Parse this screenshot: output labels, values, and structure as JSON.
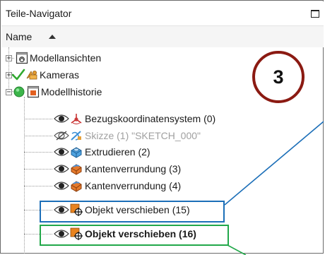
{
  "panel": {
    "title": "Teile-Navigator",
    "column_header": "Name"
  },
  "tree": {
    "items": [
      {
        "label": "Modellansichten",
        "icon": "model-views-icon",
        "expander": "+"
      },
      {
        "label": "Kameras",
        "icon": "camera-icon",
        "expander": "+"
      },
      {
        "label": "Modellhistorie",
        "icon": "model-history-icon",
        "expander": "−"
      },
      {
        "label": "Bezugskoordinatensystem (0)",
        "icon": "coordinate-system-icon"
      },
      {
        "label": "Skizze (1) \"SKETCH_000\"",
        "icon": "sketch-icon"
      },
      {
        "label": "Extrudieren (2)",
        "icon": "extrude-icon"
      },
      {
        "label": "Kantenverrundung (3)",
        "icon": "edge-blend-icon"
      },
      {
        "label": "Kantenverrundung (4)",
        "icon": "edge-blend-icon"
      },
      {
        "label": "Objekt verschieben (15)",
        "icon": "move-object-icon"
      },
      {
        "label": "Objekt verschieben (16)",
        "icon": "move-object-icon"
      }
    ]
  },
  "annotation": {
    "step_number": "3"
  },
  "colors": {
    "step_circle": "#8b1a12",
    "callout_blue": "#1c6fb8",
    "callout_green": "#22a84a",
    "checkmark": "#2fa82f"
  }
}
